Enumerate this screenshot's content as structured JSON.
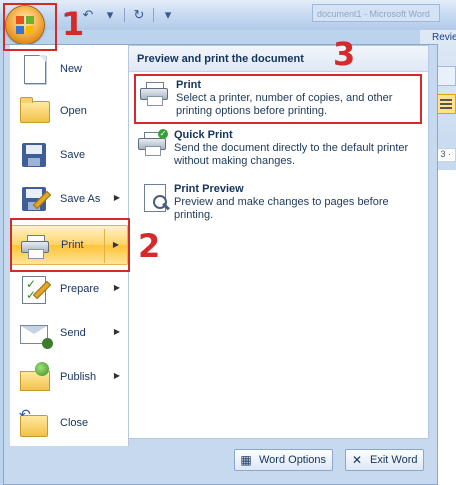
{
  "search_placeholder": "document1 - Microsoft Word",
  "background": {
    "tab_label": "Revie",
    "ruler_text": "· 3 ·"
  },
  "menu": [
    {
      "label": "New",
      "mnemonic": "N",
      "has_arrow": false,
      "icon": "new-document-icon"
    },
    {
      "label": "Open",
      "mnemonic": "O",
      "has_arrow": false,
      "icon": "open-folder-icon"
    },
    {
      "label": "Save",
      "mnemonic": "S",
      "has_arrow": false,
      "icon": "save-disk-icon"
    },
    {
      "label": "Save As",
      "mnemonic": "A",
      "has_arrow": true,
      "icon": "save-as-icon"
    },
    {
      "label": "Print",
      "mnemonic": "P",
      "has_arrow": true,
      "active": true,
      "icon": "printer-icon"
    },
    {
      "label": "Prepare",
      "mnemonic": "E",
      "has_arrow": true,
      "icon": "prepare-icon"
    },
    {
      "label": "Send",
      "mnemonic": "D",
      "has_arrow": true,
      "icon": "send-icon"
    },
    {
      "label": "Publish",
      "mnemonic": "U",
      "has_arrow": true,
      "icon": "publish-icon"
    },
    {
      "label": "Close",
      "mnemonic": "C",
      "has_arrow": false,
      "icon": "close-folder-icon"
    }
  ],
  "panel": {
    "header": "Preview and print the document",
    "options": [
      {
        "title": "Print",
        "desc": "Select a printer, number of copies, and other printing options before printing.",
        "icon": "printer-icon"
      },
      {
        "title": "Quick Print",
        "desc": "Send the document directly to the default printer without making changes.",
        "icon": "quick-print-icon"
      },
      {
        "title": "Print Preview",
        "desc": "Preview and make changes to pages before printing.",
        "icon": "print-preview-icon"
      }
    ]
  },
  "bottom": {
    "word_options": "Word Options",
    "exit_word": "Exit Word"
  },
  "annotations": {
    "step1": "1",
    "step2": "2",
    "step3": "3",
    "color": "#d42a2a"
  }
}
